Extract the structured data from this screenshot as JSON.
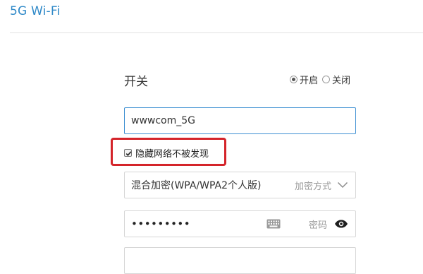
{
  "page": {
    "title": "5G Wi-Fi"
  },
  "switch": {
    "label": "开关",
    "options": [
      {
        "label": "开启",
        "selected": true
      },
      {
        "label": "关闭",
        "selected": false
      }
    ]
  },
  "ssid": {
    "value": "wwwcom_5G"
  },
  "hide_network": {
    "label": "隐藏网络不被发现",
    "checked": true
  },
  "encryption": {
    "value": "混合加密(WPA/WPA2个人版)",
    "hint": "加密方式"
  },
  "password": {
    "value": "•••••••••",
    "hint": "密码"
  },
  "colors": {
    "accent": "#2f89c8",
    "highlight": "#d4242a",
    "focus_border": "#3d8fd2"
  },
  "icons": [
    "keyboard-icon",
    "eye-icon",
    "chevron-down-icon",
    "checkmark-icon"
  ]
}
